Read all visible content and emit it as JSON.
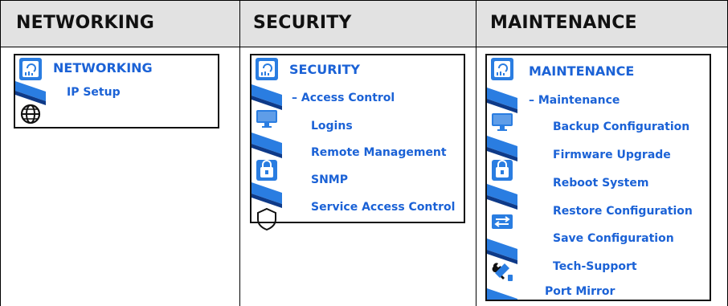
{
  "headers": {
    "networking": "NETWORKING",
    "security": "SECURITY",
    "maintenance": "MAINTENANCE"
  },
  "networking_menu": {
    "title": "NETWORKING",
    "items": [
      "IP Setup"
    ]
  },
  "security_menu": {
    "title": "SECURITY",
    "group": "– Access Control",
    "items": [
      "Logins",
      "Remote Management",
      "SNMP",
      "Service Access Control"
    ]
  },
  "maintenance_menu": {
    "title": "MAINTENANCE",
    "group": "– Maintenance",
    "items": [
      "Backup Configuration",
      "Firmware Upgrade",
      "Reboot System",
      "Restore Configuration",
      "Save Configuration",
      "Tech-Support"
    ],
    "extra_item": "Port Mirror"
  },
  "icons": {
    "dashboard": "dashboard-icon",
    "globe": "globe-icon",
    "monitor": "monitor-icon",
    "lock": "lock-icon",
    "shield": "shield-icon",
    "switch": "switch-icon",
    "tools": "tools-icon"
  },
  "colors": {
    "header_bg": "#e2e2e2",
    "link": "#1b62d6",
    "rail_blue": "#2a7de1"
  }
}
